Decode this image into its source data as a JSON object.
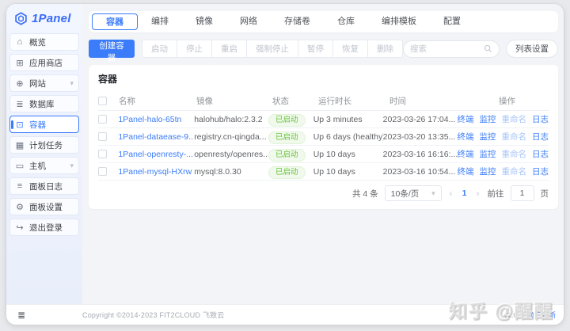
{
  "brand": {
    "name": "1Panel"
  },
  "icons": {
    "home": "⌂",
    "app_store": "⊞",
    "website": "⊕",
    "database": "≣",
    "container": "⊡",
    "cronjob": "▦",
    "host": "▭",
    "panel_log": "≡",
    "settings": "⚙",
    "logout": "↪",
    "chevron_down": "▾",
    "collapse": "≣",
    "prev": "‹",
    "next": "›"
  },
  "topnav": {
    "tabs": [
      {
        "label": "容器",
        "active": true
      },
      {
        "label": "编排",
        "active": false
      },
      {
        "label": "镜像",
        "active": false
      },
      {
        "label": "网络",
        "active": false
      },
      {
        "label": "存储卷",
        "active": false
      },
      {
        "label": "仓库",
        "active": false
      },
      {
        "label": "编排模板",
        "active": false
      },
      {
        "label": "配置",
        "active": false
      }
    ]
  },
  "sidebar": {
    "items": [
      {
        "label": "概览"
      },
      {
        "label": "应用商店"
      },
      {
        "label": "网站"
      },
      {
        "label": "数据库"
      },
      {
        "label": "容器"
      },
      {
        "label": "计划任务"
      },
      {
        "label": "主机"
      },
      {
        "label": "面板日志"
      },
      {
        "label": "面板设置"
      },
      {
        "label": "退出登录"
      }
    ]
  },
  "toolbar": {
    "create_label": "创建容器",
    "actions": [
      "启动",
      "停止",
      "重启",
      "强制停止",
      "暂停",
      "恢复",
      "删除"
    ],
    "search_placeholder": "搜索",
    "list_settings_label": "列表设置"
  },
  "panel": {
    "title": "容器"
  },
  "table": {
    "headers": {
      "name": "名称",
      "image": "镜像",
      "status": "状态",
      "uptime": "运行时长",
      "time": "时间",
      "ops": "操作"
    },
    "ops_labels": {
      "terminal": "终端",
      "monitor": "监控",
      "rename": "重命名",
      "logs": "日志"
    },
    "rows": [
      {
        "name": "1Panel-halo-65tn",
        "image": "halohub/halo:2.3.2",
        "status": "已启动",
        "uptime": "Up 3 minutes",
        "time": "2023-03-26 17:04..."
      },
      {
        "name": "1Panel-dataease-9...",
        "image": "registry.cn-qingda...",
        "status": "已启动",
        "uptime": "Up 6 days (healthy)",
        "time": "2023-03-20 13:35..."
      },
      {
        "name": "1Panel-openresty-...",
        "image": "openresty/openres...",
        "status": "已启动",
        "uptime": "Up 10 days",
        "time": "2023-03-16 16:16:..."
      },
      {
        "name": "1Panel-mysql-HXrw",
        "image": "mysql:8.0.30",
        "status": "已启动",
        "uptime": "Up 10 days",
        "time": "2023-03-16 10:54..."
      }
    ]
  },
  "pagination": {
    "total": "共 4 条",
    "page_size": "10条/页",
    "current_page": "1",
    "goto_label": "前往",
    "goto_value": "1",
    "page_unit": "页"
  },
  "footer": {
    "copyright": "Copyright ©2014-2023 FIT2CLOUD 飞致云",
    "version": "v1.0.3",
    "update_link": "检查更新"
  },
  "watermark": {
    "text": "知乎 @醒醒"
  },
  "colors": {
    "primary": "#3b7cfa",
    "success_text": "#67c23a",
    "success_bg": "#f0f9eb"
  }
}
